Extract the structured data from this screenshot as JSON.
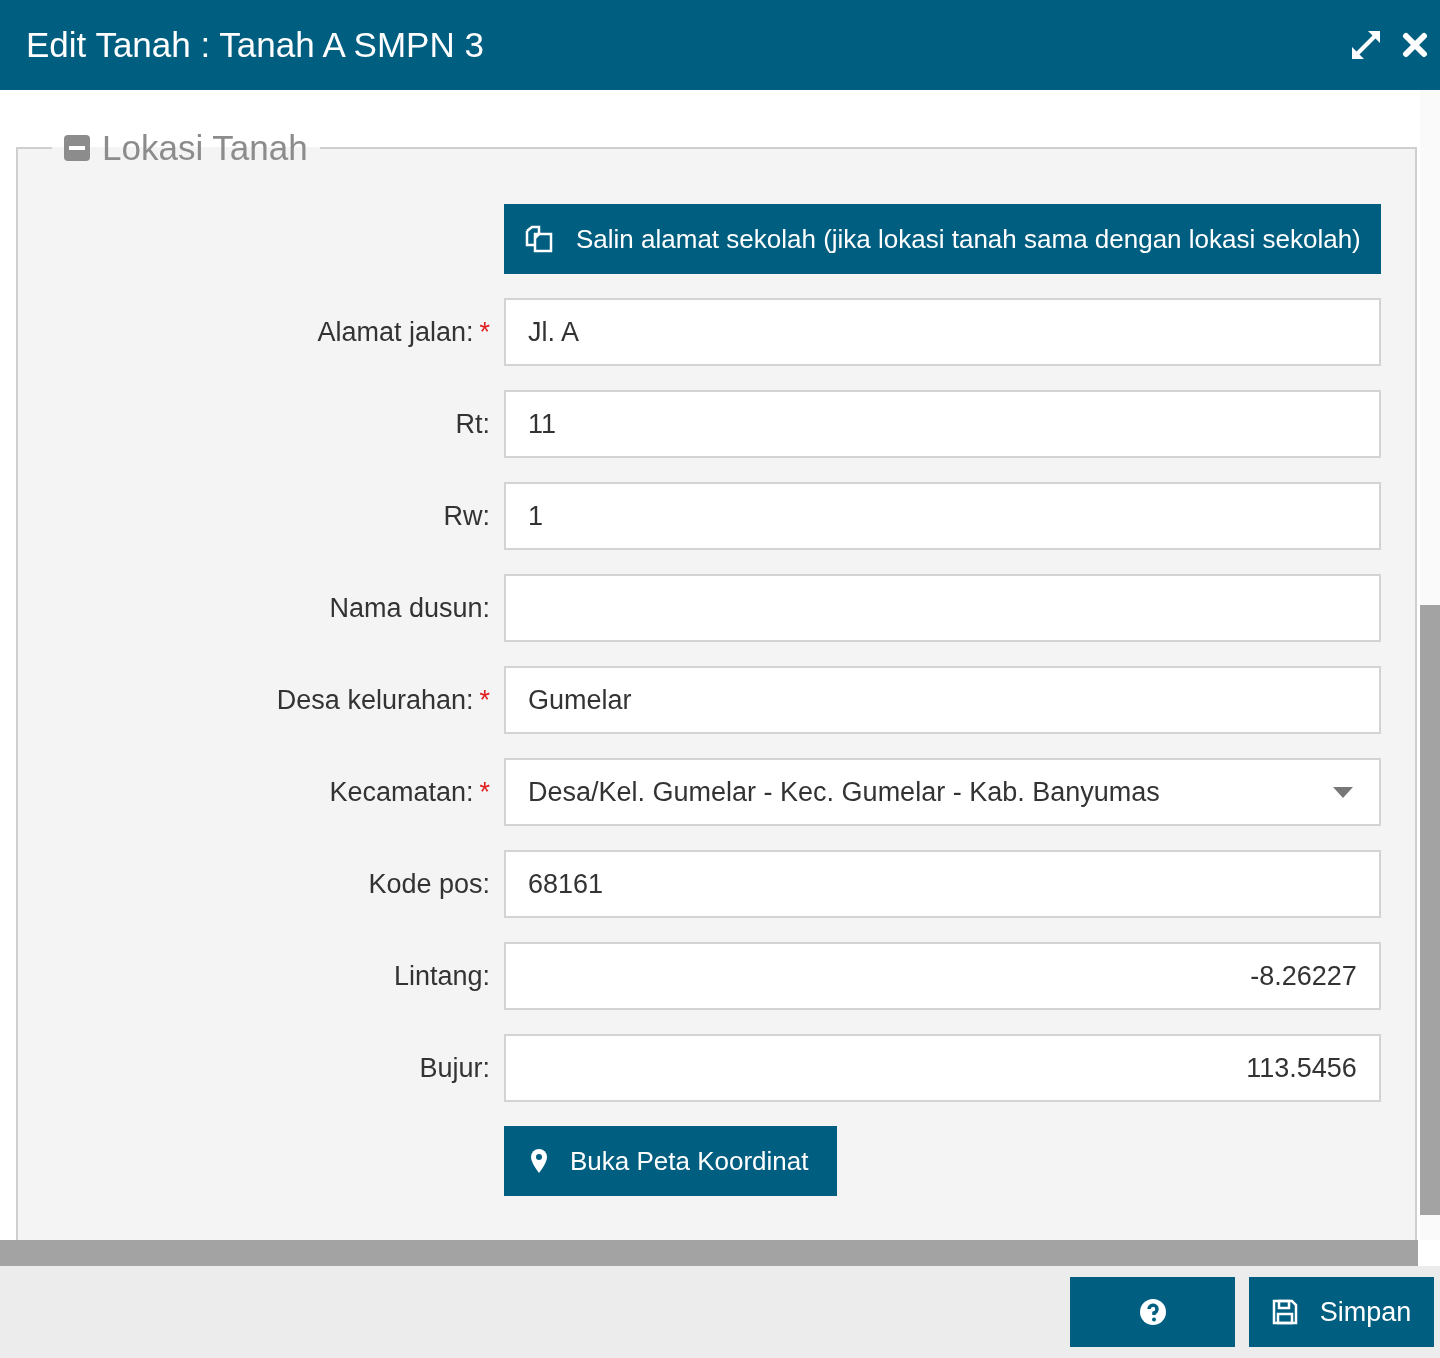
{
  "window": {
    "title": "Edit Tanah : Tanah A SMPN 3"
  },
  "section": {
    "title": "Lokasi Tanah",
    "expanded": true
  },
  "copy_button": {
    "label": "Salin alamat sekolah (jika lokasi tanah sama dengan lokasi sekolah)"
  },
  "fields": [
    {
      "label": "Alamat jalan:",
      "required": true,
      "kind": "text",
      "value": "Jl. A"
    },
    {
      "label": "Rt:",
      "required": false,
      "kind": "text",
      "value": "11"
    },
    {
      "label": "Rw:",
      "required": false,
      "kind": "text",
      "value": "1"
    },
    {
      "label": "Nama dusun:",
      "required": false,
      "kind": "text"
    },
    {
      "label": "Desa kelurahan:",
      "required": true,
      "kind": "text",
      "value": "Gumelar"
    },
    {
      "label": "Kecamatan:",
      "required": true,
      "kind": "select",
      "value": "Desa/Kel. Gumelar - Kec. Gumelar - Kab. Banyumas"
    },
    {
      "label": "Kode pos:",
      "required": false,
      "kind": "text",
      "value": "68161"
    },
    {
      "label": "Lintang:",
      "required": false,
      "kind": "number",
      "value": "-8.26227"
    },
    {
      "label": "Bujur:",
      "required": false,
      "kind": "number",
      "value": "113.5456"
    }
  ],
  "required_mark": "*",
  "map_button": {
    "label": "Buka Peta Koordinat"
  },
  "footer": {
    "save_button": {
      "label": "Simpan"
    }
  }
}
